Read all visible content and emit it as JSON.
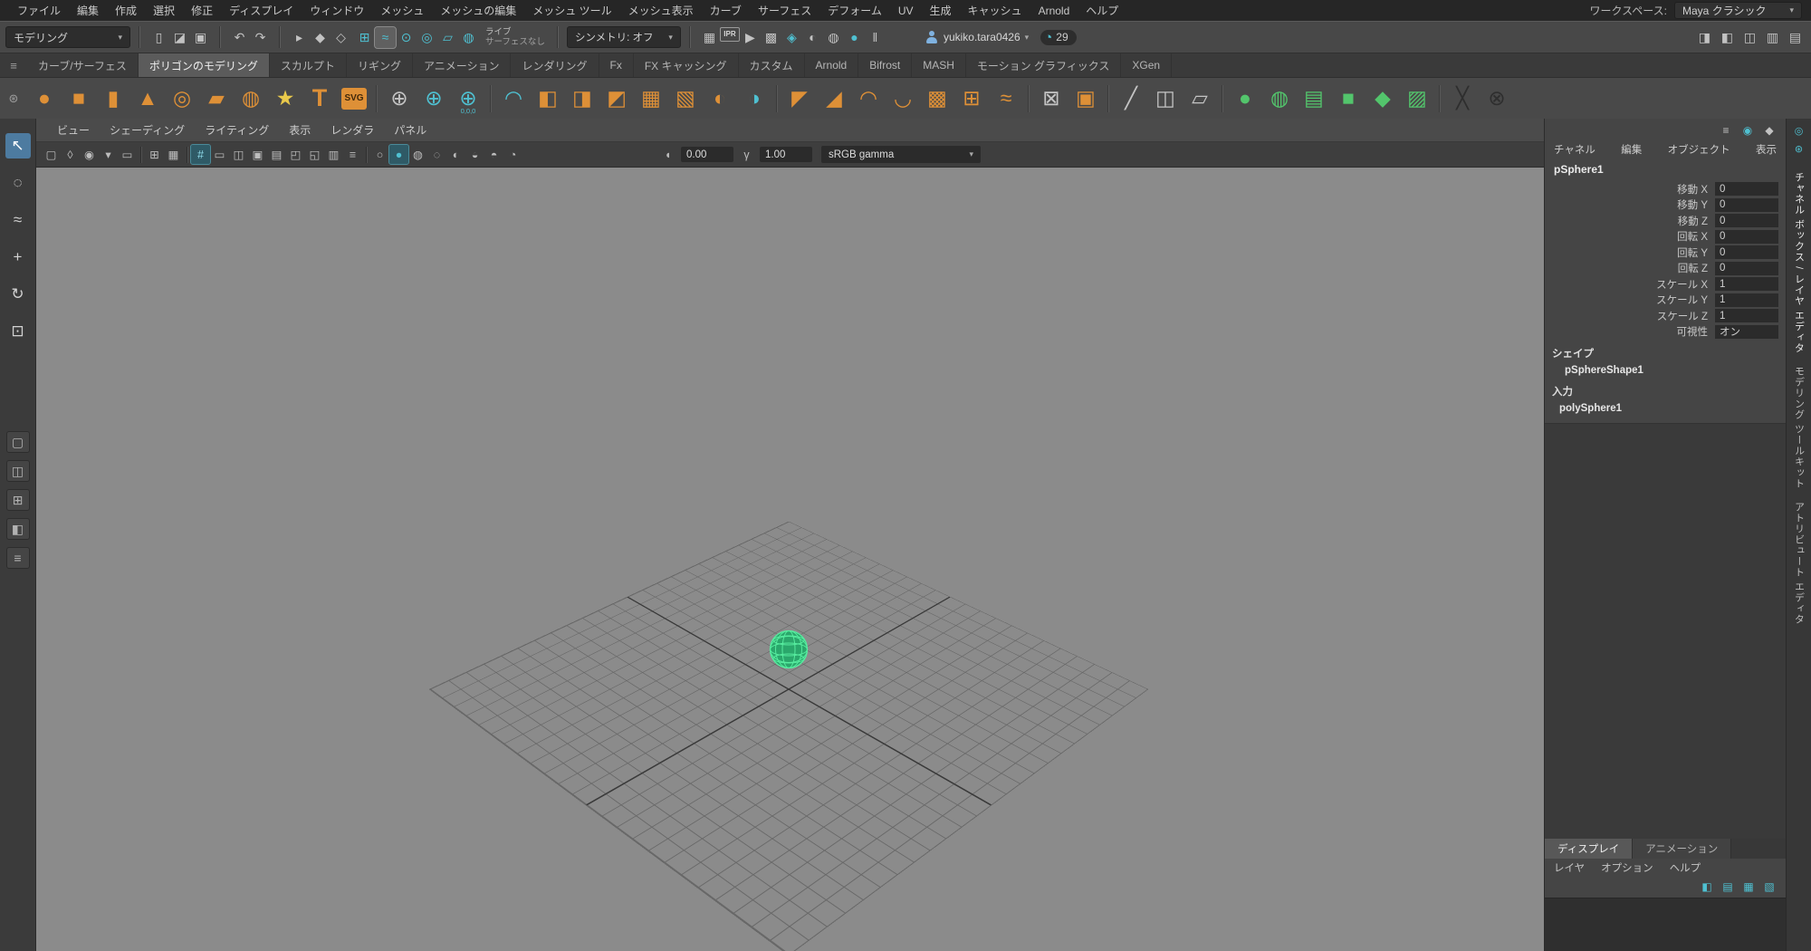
{
  "colors": {
    "menubar_bg": "#262626",
    "statusline_bg": "#484848",
    "shelf_tabs_bg": "#3a3a3a",
    "shelf_bg": "#494949",
    "toolbox_bg": "#3b3b3b",
    "panel_menubar_bg": "#4b4b4b",
    "panel_toolbar_bg": "#3e3e3e",
    "viewport_bg": "#8b8b8b",
    "grid_line": "#686868",
    "grid_axis": "#3a3a3a",
    "channelbox_bg": "#454545",
    "field_bg": "#2b2b2b",
    "accent_teal": "#4fc0d1",
    "accent_orange": "#de9037",
    "accent_yellow": "#e9c94b",
    "accent_green": "#53c56c",
    "selection_green": "#57ec9f",
    "sphere_fill": "#2aa76b",
    "active_tool_bg": "#4d7ba0"
  },
  "ui": {
    "caret": "▾",
    "menu_icon": "≡",
    "gear_icon": "⊛"
  },
  "menubar": {
    "items": [
      "ファイル",
      "編集",
      "作成",
      "選択",
      "修正",
      "ディスプレイ",
      "ウィンドウ",
      "メッシュ",
      "メッシュの編集",
      "メッシュ ツール",
      "メッシュ表示",
      "カーブ",
      "サーフェス",
      "デフォーム",
      "UV",
      "生成",
      "キャッシュ",
      "Arnold",
      "ヘルプ"
    ],
    "workspace_label": "ワークスペース:",
    "workspace_value": "Maya クラシック"
  },
  "statusline": {
    "menuset": "モデリング",
    "file_icons": [
      {
        "name": "new-scene-icon",
        "glyph": "▯"
      },
      {
        "name": "open-scene-icon",
        "glyph": "◪"
      },
      {
        "name": "save-scene-icon",
        "glyph": "▣"
      }
    ],
    "history_icons": [
      {
        "name": "undo-icon",
        "glyph": "↶"
      },
      {
        "name": "redo-icon",
        "glyph": "↷"
      }
    ],
    "mask_icons": [
      {
        "name": "select-hierarchy-mask-icon",
        "glyph": "▸"
      },
      {
        "name": "select-object-mask-icon",
        "glyph": "◆"
      },
      {
        "name": "select-component-mask-icon",
        "glyph": "◇"
      }
    ],
    "snap_icons": [
      {
        "name": "snap-to-grid-icon",
        "glyph": "⊞",
        "cls": "teal"
      },
      {
        "name": "snap-to-curve-icon",
        "glyph": "≈",
        "cls": "teal",
        "active": "true"
      },
      {
        "name": "snap-to-point-icon",
        "glyph": "⊙",
        "cls": "teal"
      },
      {
        "name": "snap-to-projected-center-icon",
        "glyph": "◎",
        "cls": "teal"
      },
      {
        "name": "snap-to-view-plane-icon",
        "glyph": "▱",
        "cls": "teal"
      },
      {
        "name": "make-live-icon",
        "glyph": "◍",
        "cls": "teal"
      }
    ],
    "live_label": "ライブ",
    "live_value": "サーフェスなし",
    "symmetry": "シンメトリ: オフ",
    "render_icons": [
      {
        "name": "render-current-frame-icon",
        "glyph": "▦"
      },
      {
        "name": "ipr-render-icon",
        "glyph": "IPR",
        "cls": "iprchip"
      },
      {
        "name": "render-sequence-icon",
        "glyph": "▶"
      },
      {
        "name": "render-settings-icon",
        "glyph": "▩"
      },
      {
        "name": "hypershade-icon",
        "glyph": "◈",
        "cls": "teal"
      },
      {
        "name": "light-editor-icon",
        "glyph": "◐"
      },
      {
        "name": "lookdev-view-icon",
        "glyph": "◍"
      },
      {
        "name": "arnold-renderview-icon",
        "glyph": "●",
        "cls": "teal"
      },
      {
        "name": "pause-icon",
        "glyph": "‖"
      }
    ],
    "user_name": "yukiko.tara0426",
    "frame_value": "29",
    "panel_toggles": [
      {
        "name": "attribute-editor-toggle-icon",
        "glyph": "◨"
      },
      {
        "name": "tool-settings-toggle-icon",
        "glyph": "◧"
      },
      {
        "name": "channel-box-toggle-icon",
        "glyph": "◫"
      },
      {
        "name": "modeling-toolkit-toggle-icon",
        "glyph": "▥"
      },
      {
        "name": "workspace-panel-toggle-icon",
        "glyph": "▤"
      }
    ]
  },
  "shelf": {
    "tabs": [
      {
        "label": "カーブ/サーフェス"
      },
      {
        "label": "ポリゴンのモデリング",
        "active": "true"
      },
      {
        "label": "スカルプト"
      },
      {
        "label": "リギング"
      },
      {
        "label": "アニメーション"
      },
      {
        "label": "レンダリング"
      },
      {
        "label": "Fx"
      },
      {
        "label": "FX キャッシング"
      },
      {
        "label": "カスタム"
      },
      {
        "label": "Arnold"
      },
      {
        "label": "Bifrost"
      },
      {
        "label": "MASH"
      },
      {
        "label": "モーション グラフィックス"
      },
      {
        "label": "XGen"
      }
    ],
    "icons": [
      {
        "name": "poly-sphere-icon",
        "glyph": "●",
        "cls": "orange"
      },
      {
        "name": "poly-cube-icon",
        "glyph": "■",
        "cls": "orange"
      },
      {
        "name": "poly-cylinder-icon",
        "glyph": "▮",
        "cls": "orange"
      },
      {
        "name": "poly-cone-icon",
        "glyph": "▲",
        "cls": "orange"
      },
      {
        "name": "poly-torus-icon",
        "glyph": "◎",
        "cls": "orange"
      },
      {
        "name": "poly-plane-icon",
        "glyph": "▰",
        "cls": "orange"
      },
      {
        "name": "poly-disc-icon",
        "glyph": "◍",
        "cls": "orange"
      },
      {
        "name": "poly-star-icon",
        "glyph": "★",
        "cls": "yellow"
      },
      {
        "name": "type-tool-icon",
        "glyph": "T",
        "cls": "orange-text"
      },
      {
        "name": "svg-tool-icon",
        "glyph": "SVG",
        "cls": "badge"
      },
      {
        "name": "shelf-separator",
        "cls": "sep"
      },
      {
        "name": "show-origin-icon",
        "glyph": "⊕",
        "cls": "gray"
      },
      {
        "name": "center-pivot-icon",
        "glyph": "⊕",
        "cls": "teal"
      },
      {
        "name": "move-to-origin-icon",
        "glyph": "⊕",
        "cls": "teal",
        "sub": "0,0,0"
      },
      {
        "name": "shelf-separator",
        "cls": "sep"
      },
      {
        "name": "sweep-mesh-icon",
        "glyph": "◠",
        "cls": "teal"
      },
      {
        "name": "boolean-union-icon",
        "glyph": "◧",
        "cls": "orange"
      },
      {
        "name": "boolean-difference-icon",
        "glyph": "◨",
        "cls": "orange"
      },
      {
        "name": "boolean-intersection-icon",
        "glyph": "◩",
        "cls": "orange"
      },
      {
        "name": "combine-icon",
        "glyph": "▦",
        "cls": "orange"
      },
      {
        "name": "separate-icon",
        "glyph": "▧",
        "cls": "orange"
      },
      {
        "name": "mirror-icon",
        "glyph": "◐",
        "cls": "orange"
      },
      {
        "name": "flip-icon",
        "glyph": "◑",
        "cls": "teal"
      },
      {
        "name": "shelf-separator",
        "cls": "sep"
      },
      {
        "name": "extrude-icon",
        "glyph": "◤",
        "cls": "orange"
      },
      {
        "name": "bevel-icon",
        "glyph": "◢",
        "cls": "orange"
      },
      {
        "name": "bridge-icon",
        "glyph": "◠",
        "cls": "orange"
      },
      {
        "name": "fill-hole-icon",
        "glyph": "◡",
        "cls": "orange"
      },
      {
        "name": "smooth-icon",
        "glyph": "▩",
        "cls": "orange"
      },
      {
        "name": "add-divisions-icon",
        "glyph": "⊞",
        "cls": "orange"
      },
      {
        "name": "edit-edge-flow-icon",
        "glyph": "≈",
        "cls": "orange"
      },
      {
        "name": "shelf-separator",
        "cls": "sep"
      },
      {
        "name": "lattice-icon",
        "glyph": "⊠",
        "cls": "gray"
      },
      {
        "name": "wrap-deformer-icon",
        "glyph": "▣",
        "cls": "orange"
      },
      {
        "name": "shelf-separator",
        "cls": "sep"
      },
      {
        "name": "multi-cut-icon",
        "glyph": "╱",
        "cls": "gray"
      },
      {
        "name": "connect-tool-icon",
        "glyph": "◫",
        "cls": "gray"
      },
      {
        "name": "quad-draw-icon",
        "glyph": "▱",
        "cls": "gray"
      },
      {
        "name": "shelf-separator",
        "cls": "sep"
      },
      {
        "name": "paint-sculpt-icon",
        "glyph": "●",
        "cls": "green"
      },
      {
        "name": "sculpt-smooth-icon",
        "glyph": "◍",
        "cls": "green"
      },
      {
        "name": "sculpt-relax-icon",
        "glyph": "▤",
        "cls": "green"
      },
      {
        "name": "sculpt-grab-icon",
        "glyph": "■",
        "cls": "green"
      },
      {
        "name": "sculpt-pinch-icon",
        "glyph": "◆",
        "cls": "green"
      },
      {
        "name": "sculpt-flatten-icon",
        "glyph": "▨",
        "cls": "green"
      },
      {
        "name": "shelf-separator",
        "cls": "sep"
      },
      {
        "name": "slide-edge-icon",
        "glyph": "╳",
        "cls": "dark"
      },
      {
        "name": "target-weld-icon",
        "glyph": "⊗",
        "cls": "dark"
      }
    ]
  },
  "toolbox": {
    "tools": [
      {
        "name": "select-tool-icon",
        "glyph": "↖",
        "active": "true"
      },
      {
        "name": "lasso-tool-icon",
        "glyph": "◌"
      },
      {
        "name": "paint-select-tool-icon",
        "glyph": "≈"
      },
      {
        "name": "move-tool-icon",
        "glyph": "+"
      },
      {
        "name": "rotate-tool-icon",
        "glyph": "↻"
      },
      {
        "name": "scale-tool-icon",
        "glyph": "⊡"
      }
    ],
    "layouts": [
      {
        "name": "layout-single-pane-icon",
        "glyph": "▢"
      },
      {
        "name": "layout-two-panes-icon",
        "glyph": "◫"
      },
      {
        "name": "layout-four-panes-icon",
        "glyph": "⊞"
      },
      {
        "name": "layout-persp-outliner-icon",
        "glyph": "◧"
      },
      {
        "name": "outliner-icon",
        "glyph": "≡"
      }
    ]
  },
  "panel": {
    "menus": [
      "ビュー",
      "シェーディング",
      "ライティング",
      "表示",
      "レンダラ",
      "パネル"
    ],
    "toolbar": {
      "icons": [
        {
          "name": "select-camera-icon",
          "glyph": "▢"
        },
        {
          "name": "lock-camera-icon",
          "glyph": "◊"
        },
        {
          "name": "camera-attributes-icon",
          "glyph": "◉"
        },
        {
          "name": "bookmarks-icon",
          "glyph": "▾"
        },
        {
          "name": "image-plane-icon",
          "glyph": "▭"
        },
        {
          "name": "pt-separator",
          "cls": "sep"
        },
        {
          "name": "2d-pan-zoom-icon",
          "glyph": "⊞"
        },
        {
          "name": "oversampling-icon",
          "glyph": "▦"
        },
        {
          "name": "pt-separator",
          "cls": "sep"
        },
        {
          "name": "grid-toggle-icon",
          "glyph": "#",
          "active": "true"
        },
        {
          "name": "film-gate-icon",
          "glyph": "▭"
        },
        {
          "name": "resolution-gate-icon",
          "glyph": "◫"
        },
        {
          "name": "gate-mask-icon",
          "glyph": "▣"
        },
        {
          "name": "field-chart-icon",
          "glyph": "▤"
        },
        {
          "name": "safe-action-icon",
          "glyph": "◰"
        },
        {
          "name": "safe-title-icon",
          "glyph": "◱"
        },
        {
          "name": "hud-toggle-icon",
          "glyph": "▥"
        },
        {
          "name": "object-details-icon",
          "glyph": "≡"
        },
        {
          "name": "pt-separator",
          "cls": "sep"
        },
        {
          "name": "wireframe-icon",
          "glyph": "○"
        },
        {
          "name": "smooth-shade-icon",
          "glyph": "●",
          "active": "true",
          "cls": "teal"
        },
        {
          "name": "textured-icon",
          "glyph": "◍"
        },
        {
          "name": "use-default-material-icon",
          "glyph": "◌"
        },
        {
          "name": "lights-icon",
          "glyph": "◐"
        },
        {
          "name": "shadows-icon",
          "glyph": "◒"
        },
        {
          "name": "ao-icon",
          "glyph": "◓"
        },
        {
          "name": "motion-blur-icon",
          "glyph": "◔"
        }
      ],
      "exposure_icon": "◖",
      "exposure": "0.00",
      "gamma_icon": "γ",
      "gamma": "1.00",
      "colorspace": "sRGB gamma"
    }
  },
  "channelbox": {
    "top_icons": [
      {
        "name": "channel-display-icon",
        "glyph": "≡",
        "cls": "gray"
      },
      {
        "name": "show-manipulator-icon",
        "glyph": "◉",
        "cls": "teal"
      },
      {
        "name": "channel-key-icon",
        "glyph": "◆",
        "cls": "gray"
      }
    ],
    "menus": [
      "チャネル",
      "編集",
      "オブジェクト",
      "表示"
    ],
    "object_name": "pSphere1",
    "rows": [
      {
        "label": "移動 X",
        "value": "0"
      },
      {
        "label": "移動 Y",
        "value": "0"
      },
      {
        "label": "移動 Z",
        "value": "0"
      },
      {
        "label": "回転 X",
        "value": "0"
      },
      {
        "label": "回転 Y",
        "value": "0"
      },
      {
        "label": "回転 Z",
        "value": "0"
      },
      {
        "label": "スケール X",
        "value": "1"
      },
      {
        "label": "スケール Y",
        "value": "1"
      },
      {
        "label": "スケール Z",
        "value": "1"
      },
      {
        "label": "可視性",
        "value": "オン"
      }
    ],
    "shape_header": "シェイプ",
    "shape_name": "pSphereShape1",
    "inputs_header": "入力",
    "input_name": "polySphere1"
  },
  "layer_editor": {
    "tabs": [
      {
        "label": "ディスプレイ",
        "active": "true"
      },
      {
        "label": "アニメーション"
      }
    ],
    "menus": [
      "レイヤ",
      "オプション",
      "ヘルプ"
    ],
    "icons": [
      {
        "name": "layer-visibility-icon",
        "glyph": "◧",
        "cls": "teal"
      },
      {
        "name": "new-empty-layer-icon",
        "glyph": "▤",
        "cls": "teal"
      },
      {
        "name": "new-layer-from-selected-icon",
        "glyph": "▦",
        "cls": "teal"
      },
      {
        "name": "layer-options-icon",
        "glyph": "▧",
        "cls": "teal"
      }
    ]
  },
  "right_strip": {
    "top_icons": [
      {
        "name": "strip-pin-icon",
        "glyph": "◎"
      },
      {
        "name": "strip-gear-icon",
        "glyph": "⊛"
      }
    ],
    "tabs": [
      {
        "label": "チャネル ボックス / レイヤ エディタ",
        "active": "true"
      },
      {
        "label": "モデリング ツールキット"
      },
      {
        "label": "アトリビュート エディタ"
      }
    ]
  }
}
